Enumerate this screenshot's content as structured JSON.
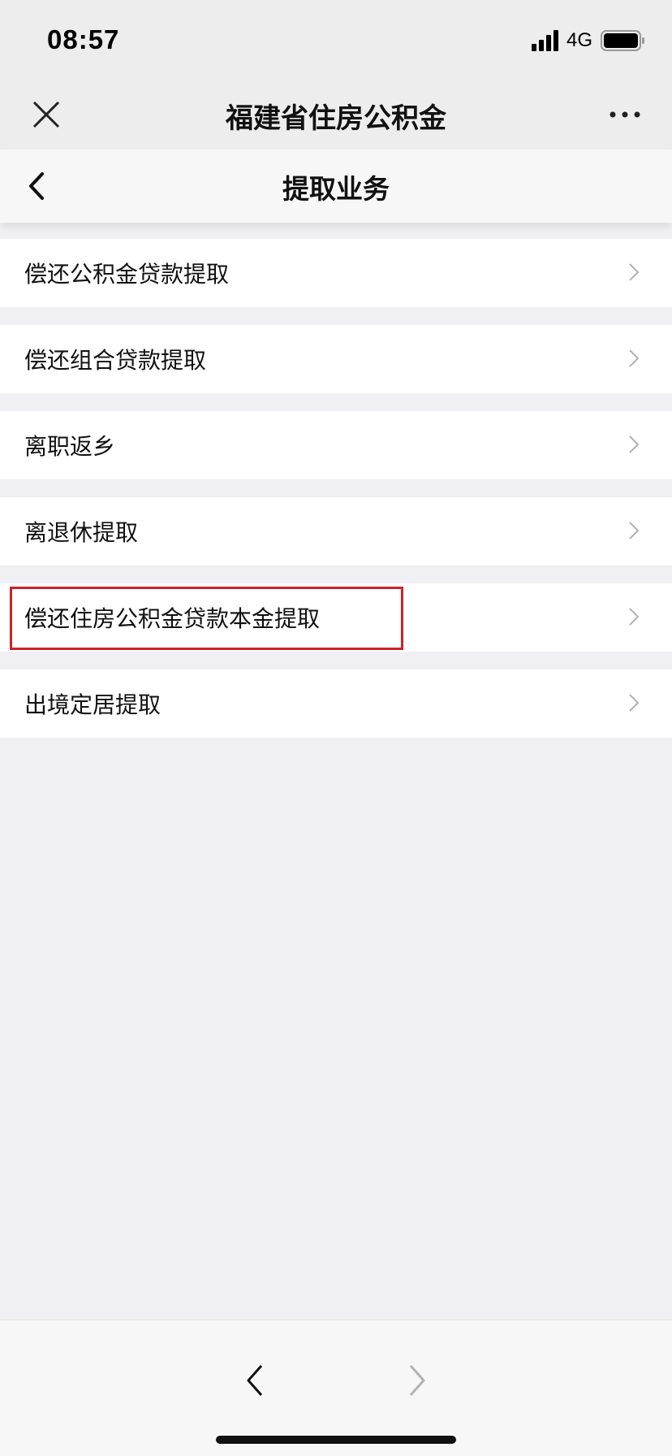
{
  "status_bar": {
    "time": "08:57",
    "network": "4G",
    "icons": [
      "signal-icon",
      "battery-icon"
    ]
  },
  "wechat_bar": {
    "title": "福建省住房公积金",
    "icons": [
      "close-icon",
      "more-icon"
    ]
  },
  "page_header": {
    "title": "提取业务",
    "icons": [
      "chevron-left-icon"
    ]
  },
  "menu": {
    "items": [
      {
        "label": "偿还公积金贷款提取"
      },
      {
        "label": "偿还组合贷款提取"
      },
      {
        "label": "离职返乡"
      },
      {
        "label": "离退休提取"
      },
      {
        "label": "偿还住房公积金贷款本金提取",
        "highlighted": true
      },
      {
        "label": "出境定居提取"
      }
    ],
    "item_icon": "chevron-right-icon"
  },
  "annotation": {
    "color": "#cc2228"
  },
  "bottom_bar": {
    "icons": [
      "browser-back-icon",
      "browser-forward-icon"
    ]
  }
}
